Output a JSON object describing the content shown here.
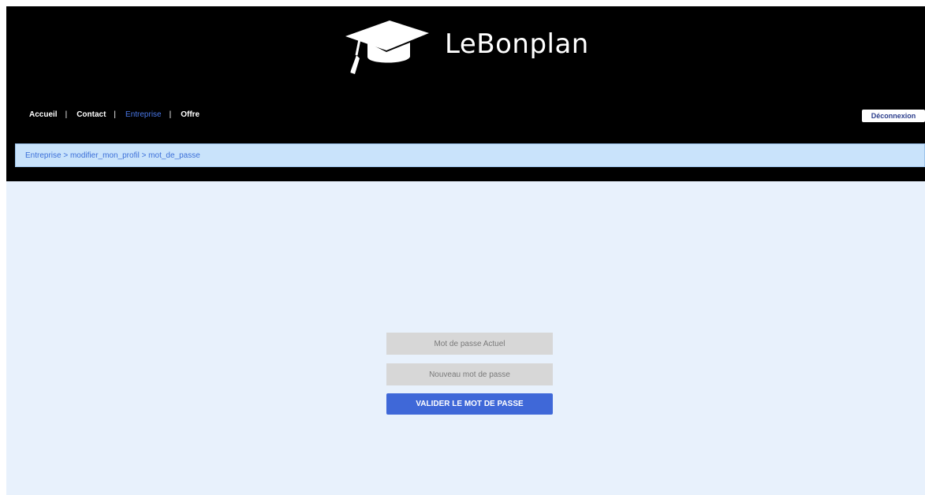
{
  "brand": {
    "name": "LeBonplan",
    "icon": "graduation-cap-icon"
  },
  "nav": {
    "items": [
      {
        "label": "Accueil"
      },
      {
        "label": "Contact"
      },
      {
        "label": "Entreprise"
      },
      {
        "label": "Offre"
      }
    ],
    "separator": "|",
    "active": "Entreprise",
    "logout_label": "Déconnexion"
  },
  "breadcrumb": {
    "text": "Entreprise > modifier_mon_profil > mot_de_passe"
  },
  "form": {
    "current_password_placeholder": "Mot de passe Actuel",
    "new_password_placeholder": "Nouveau mot de passe",
    "submit_label": "VALIDER LE MOT DE PASSE"
  },
  "colors": {
    "header_bg": "#000000",
    "main_bg": "#e8f1fc",
    "breadcrumb_bg": "#c9e3fb",
    "accent": "#3f68d8",
    "active_nav": "#4a78e8"
  }
}
